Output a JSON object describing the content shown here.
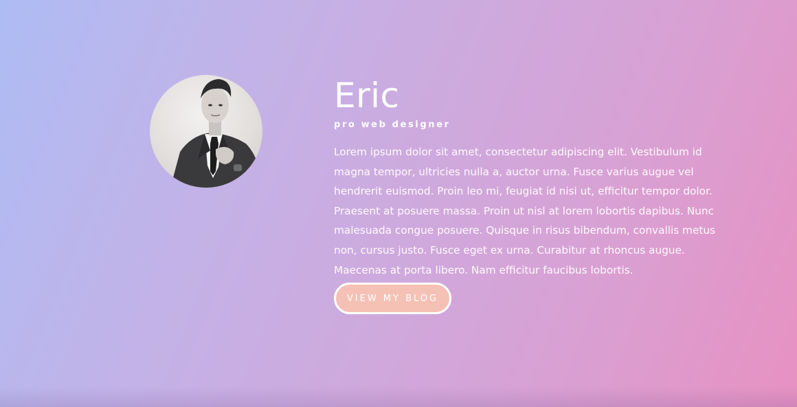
{
  "profile": {
    "name": "Eric",
    "role": "pro web designer",
    "bio": "Lorem ipsum dolor sit amet, consectetur adipiscing elit. Vestibulum id magna tempor, ultricies nulla a, auctor urna. Fusce varius augue vel hendrerit euismod. Proin leo mi, feugiat id nisi ut, efficitur tempor dolor. Praesent at posuere massa. Proin ut nisl at lorem lobortis dapibus. Nunc malesuada congue posuere. Quisque in risus bibendum, convallis metus non, cursus justo. Fusce eget ex urna. Curabitur at rhoncus augue. Maecenas at porta libero. Nam efficitur faucibus lobortis.",
    "avatar_icon": "portrait-photo"
  },
  "actions": {
    "blog_label": "VIEW MY BLOG"
  },
  "colors": {
    "gradient_start": "#aebcf4",
    "gradient_end": "#e791c2",
    "button_fill": "#f5c1b5",
    "text": "#ffffff"
  }
}
